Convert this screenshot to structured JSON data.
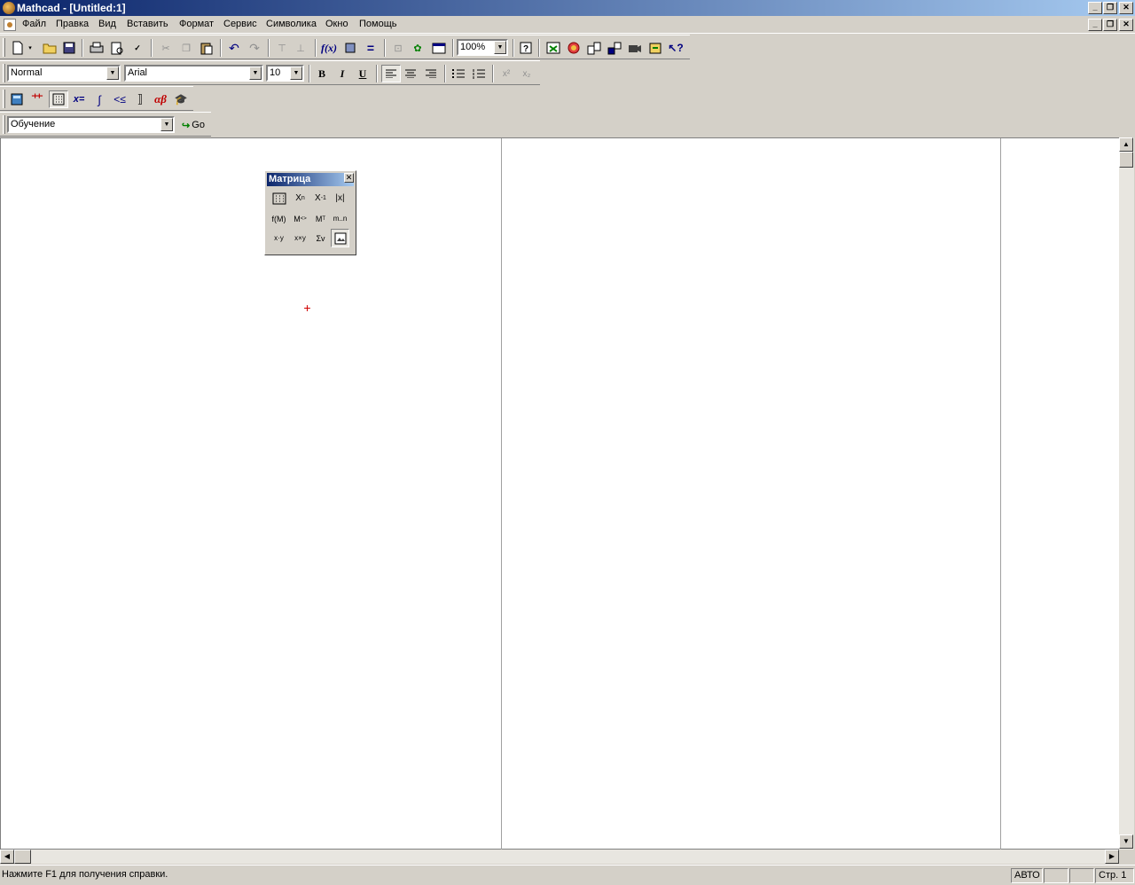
{
  "window": {
    "title": "Mathcad - [Untitled:1]"
  },
  "menu": {
    "items": [
      "Файл",
      "Правка",
      "Вид",
      "Вставить",
      "Формат",
      "Сервис",
      "Символика",
      "Окно",
      "Помощь"
    ]
  },
  "formatting": {
    "style": "Normal",
    "font": "Arial",
    "size": "10",
    "bold": "B",
    "italic": "I",
    "underline": "U"
  },
  "standard": {
    "zoom": "100%"
  },
  "resources": {
    "selected": "Обучение",
    "go_label": "Go"
  },
  "palette": {
    "title": "Матрица"
  },
  "status": {
    "help_text": "Нажмите F1 для получения справки.",
    "mode": "АВТО",
    "page": "Стр. 1"
  }
}
